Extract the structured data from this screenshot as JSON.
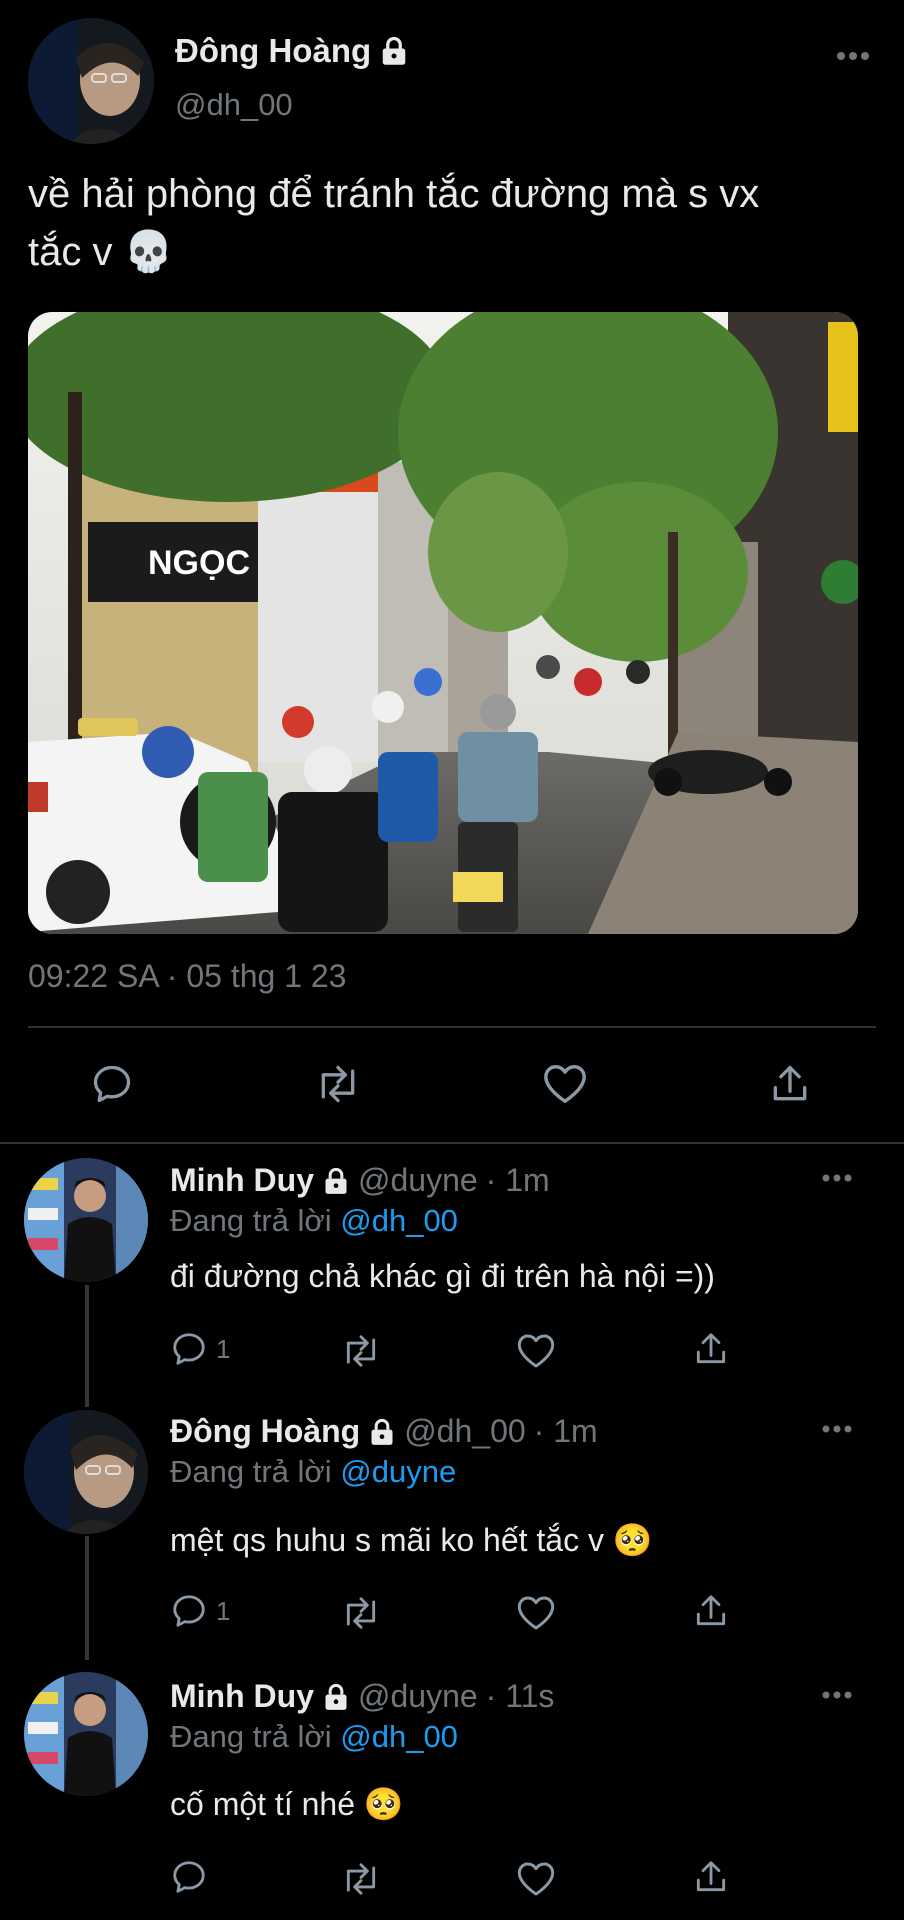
{
  "tweet": {
    "display_name": "Đông Hoàng",
    "handle": "@dh_00",
    "text_line1": "về hải phòng để tránh tắc đường mà s vx",
    "text_line2": "tắc v",
    "emoji": "💀",
    "photo_sign_text": "NGỌC MON",
    "timestamp": "09:22 SA · 05 thg 1 23",
    "more_icon": "more-horizontal-icon",
    "actions": [
      "reply-icon",
      "retweet-icon",
      "like-icon",
      "share-icon"
    ]
  },
  "replies": [
    {
      "display_name": "Minh Duy",
      "handle": "@duyne",
      "time": "· 1m",
      "replying_prefix": "Đang trả lời",
      "replying_to": "@dh_00",
      "text": "đi đường chả khác gì đi trên hà nội =))",
      "emoji": "",
      "reply_count": "1"
    },
    {
      "display_name": "Đông Hoàng",
      "handle": "@dh_00",
      "time": "· 1m",
      "replying_prefix": "Đang trả lời",
      "replying_to": "@duyne",
      "text": "mệt qs huhu s mãi ko hết tắc v",
      "emoji": "🥺",
      "reply_count": "1"
    },
    {
      "display_name": "Minh Duy",
      "handle": "@duyne",
      "time": "· 11s",
      "replying_prefix": "Đang trả lời",
      "replying_to": "@dh_00",
      "text": "cố một tí nhé",
      "emoji": "🥺",
      "reply_count": ""
    }
  ],
  "colors": {
    "background": "#000000",
    "text": "#e7e9ea",
    "muted": "#71767b",
    "link": "#1d9bf0"
  }
}
